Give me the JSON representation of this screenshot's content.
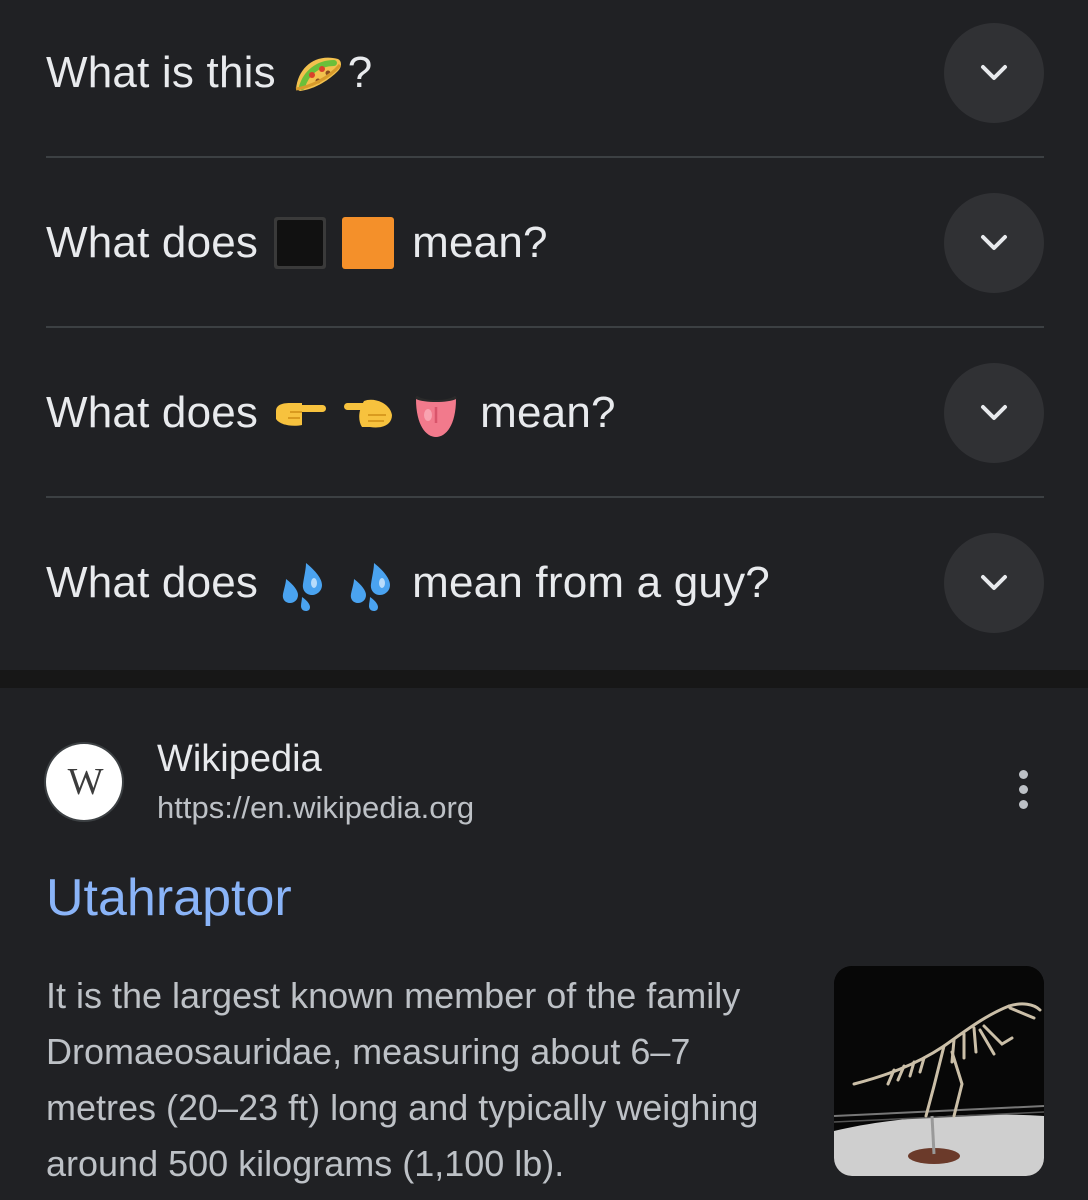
{
  "people_also_ask": [
    {
      "before": "What is this",
      "emojis": [
        "taco"
      ],
      "after": "?"
    },
    {
      "before": "What does",
      "emojis": [
        "black-large-square",
        "orange-square"
      ],
      "after": "mean?"
    },
    {
      "before": "What does",
      "emojis": [
        "backhand-index-pointing-right",
        "backhand-index-pointing-right",
        "tongue"
      ],
      "after": "mean?"
    },
    {
      "before": "What does",
      "emojis": [
        "sweat-droplets",
        "sweat-droplets"
      ],
      "after": "mean from a guy?"
    }
  ],
  "result": {
    "site_logo_letter": "W",
    "site_name": "Wikipedia",
    "site_url": "https://en.wikipedia.org",
    "title": "Utahraptor",
    "snippet": "It is the largest known member of the family Dromaeosauridae, measuring about 6–7 metres (20–23 ft) long and typically weighing around 500 kilograms (1,100 lb).",
    "thumbnail": "utahraptor-skeleton-photo"
  },
  "colors": {
    "background": "#202124",
    "text": "#e8eaed",
    "link": "#8ab4f8",
    "muted": "#bdc1c6",
    "divider": "#3c4043"
  }
}
